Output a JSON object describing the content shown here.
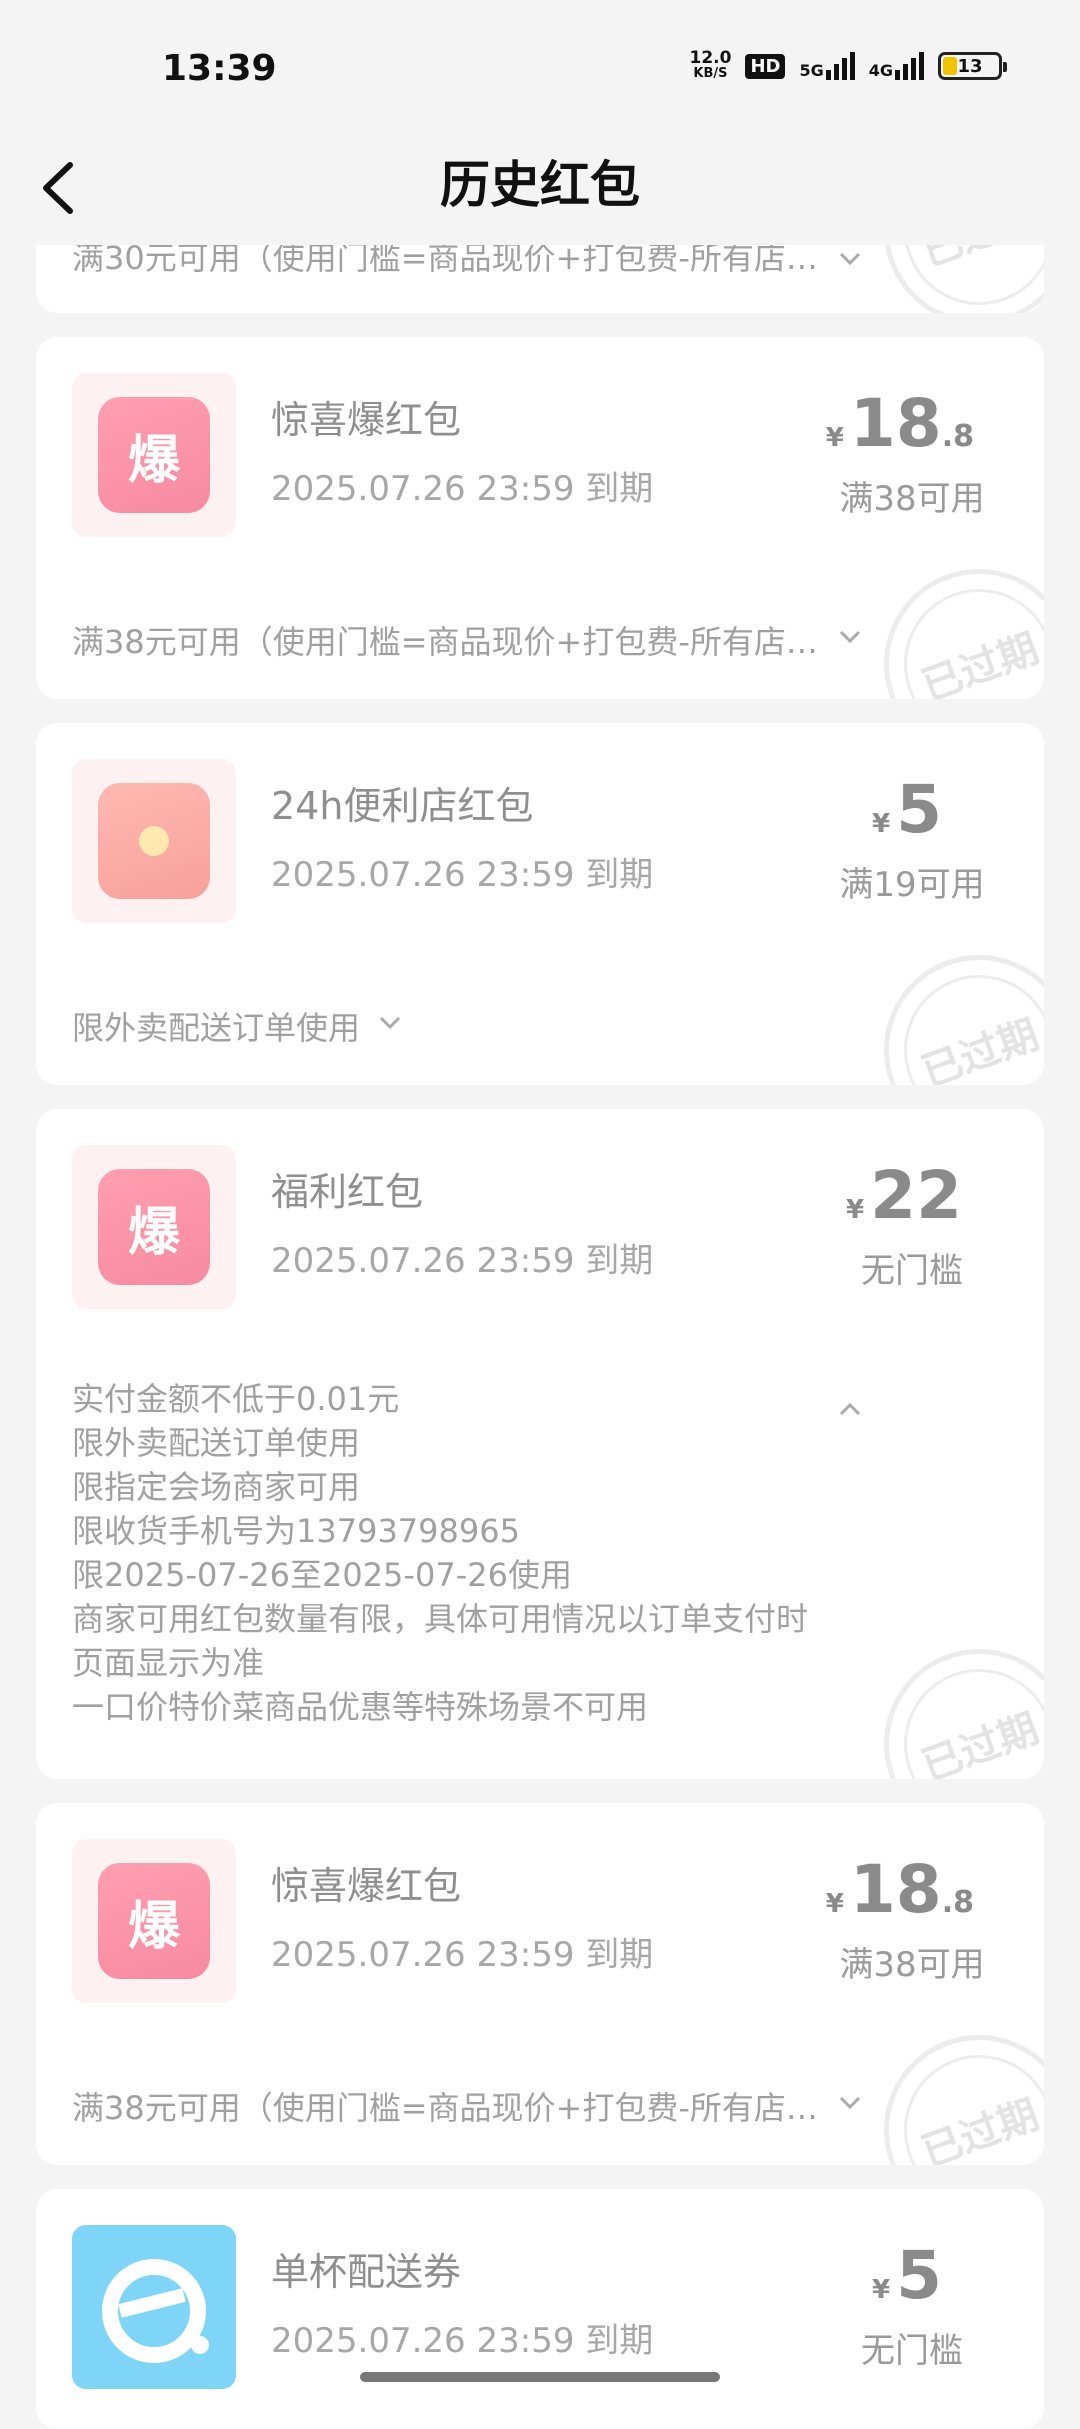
{
  "status": {
    "time": "13:39",
    "net_speed_value": "12.0",
    "net_speed_unit": "KB/S",
    "hd_label": "HD",
    "signal_5g": "5G",
    "signal_4g": "4G",
    "battery": "13"
  },
  "header": {
    "title": "历史红包"
  },
  "top_partial": {
    "desc": "满30元可用（使用门槛=商品现价+打包费-所有店…"
  },
  "stamp_text": "已过期",
  "cards": [
    {
      "name": "惊喜爆红包",
      "icon_char": "爆",
      "expiry": "2025.07.26 23:59 到期",
      "currency": "¥",
      "amount_int": "18",
      "amount_dec": ".8",
      "condition": "满38可用",
      "desc": "满38元可用（使用门槛=商品现价+打包费-所有店…"
    },
    {
      "name": "24h便利店红包",
      "icon_char": "",
      "expiry": "2025.07.26 23:59 到期",
      "currency": "¥",
      "amount_int": "5",
      "amount_dec": "",
      "condition": "满19可用",
      "desc": "限外卖配送订单使用"
    },
    {
      "name": "福利红包",
      "icon_char": "爆",
      "expiry": "2025.07.26 23:59 到期",
      "currency": "¥",
      "amount_int": "22",
      "amount_dec": "",
      "condition": "无门槛",
      "details": [
        "实付金额不低于0.01元",
        "限外卖配送订单使用",
        "限指定会场商家可用",
        "限收货手机号为13793798965",
        "限2025-07-26至2025-07-26使用",
        "商家可用红包数量有限，具体可用情况以订单支付时页面显示为准",
        "一口价特价菜商品优惠等特殊场景不可用"
      ]
    },
    {
      "name": "惊喜爆红包",
      "icon_char": "爆",
      "expiry": "2025.07.26 23:59 到期",
      "currency": "¥",
      "amount_int": "18",
      "amount_dec": ".8",
      "condition": "满38可用",
      "desc": "满38元可用（使用门槛=商品现价+打包费-所有店…"
    },
    {
      "name": "单杯配送券",
      "icon_char": "",
      "expiry": "2025.07.26 23:59 到期",
      "currency": "¥",
      "amount_int": "5",
      "amount_dec": "",
      "condition": "无门槛"
    }
  ]
}
